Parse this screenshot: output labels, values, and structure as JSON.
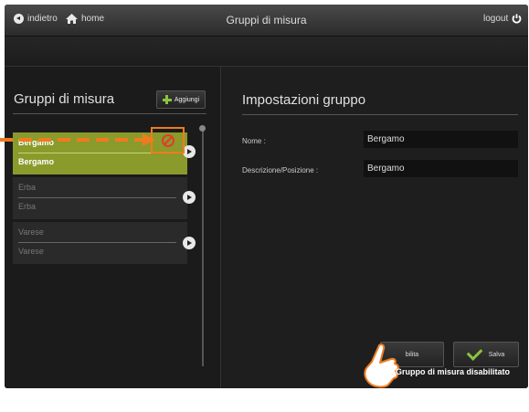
{
  "topbar": {
    "back_label": "indietro",
    "home_label": "home",
    "title": "Gruppi di misura",
    "logout_label": "logout"
  },
  "left": {
    "title": "Gruppi di misura",
    "add_label": "Aggiungi",
    "items": [
      {
        "name": "Bergamo",
        "description": "Bergamo",
        "selected": true
      },
      {
        "name": "Erba",
        "description": "Erba",
        "selected": false
      },
      {
        "name": "Varese",
        "description": "Varese",
        "selected": false
      }
    ]
  },
  "right": {
    "title": "Impostazioni gruppo",
    "name_label": "Nome :",
    "name_value": "Bergamo",
    "desc_label": "Descrizione/Posizione :",
    "desc_value": "Bergamo",
    "disable_label": "bilita",
    "save_label": "Salva"
  },
  "status": "Gruppo di misura disabilitato",
  "colors": {
    "accent_green": "#8bc43f",
    "selected_bg": "#8a9b2b",
    "highlight_orange": "#f07b1e",
    "disable_red": "#e23b2c"
  }
}
